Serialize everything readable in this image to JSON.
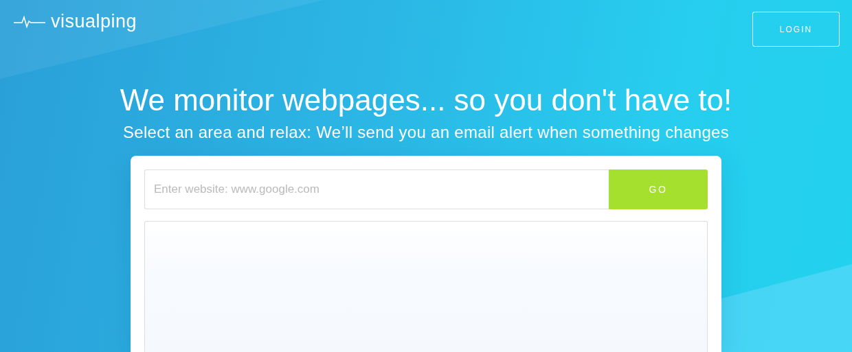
{
  "header": {
    "logo": "visualping",
    "login_button": "LOGIN"
  },
  "hero": {
    "title": "We monitor webpages... so you don't have to!",
    "subtitle": "Select an area and relax: We’ll send you an email alert when something changes"
  },
  "monitor": {
    "url_field": {
      "placeholder": "Enter website: www.google.com"
    },
    "go_button": "GO"
  }
}
